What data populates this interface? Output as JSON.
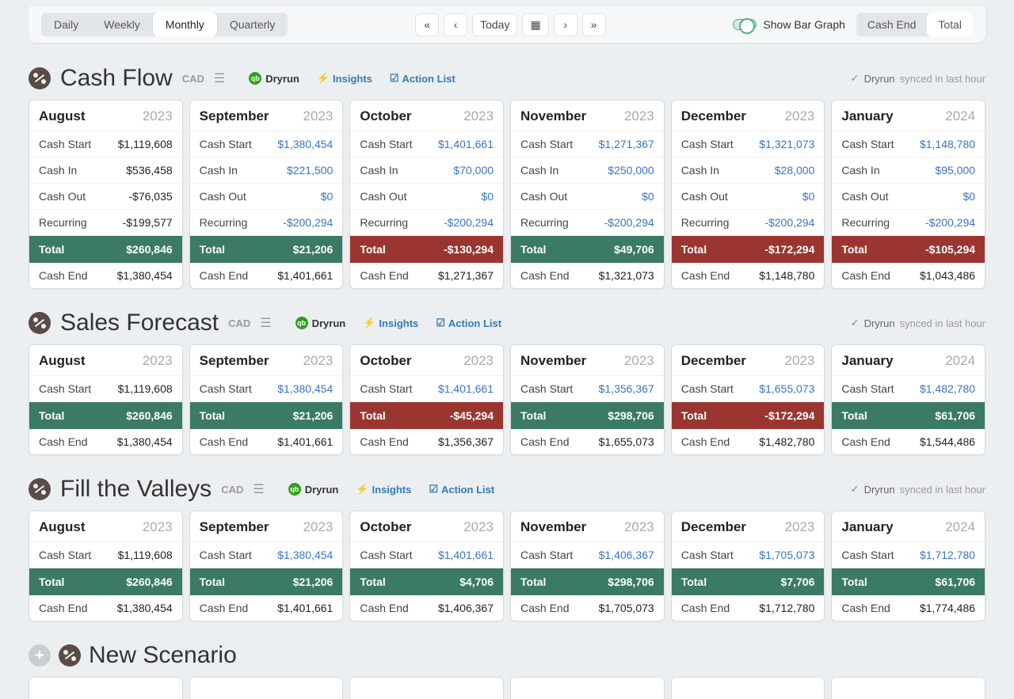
{
  "toolbar": {
    "periods": [
      "Daily",
      "Weekly",
      "Monthly",
      "Quarterly"
    ],
    "today": "Today",
    "show_graph": "Show Bar Graph",
    "totals": [
      "Cash End",
      "Total"
    ]
  },
  "sync": {
    "brand": "Dryrun",
    "text": "synced in last hour"
  },
  "links": {
    "dryrun": "Dryrun",
    "insights": "Insights",
    "actions": "Action List"
  },
  "sections": [
    {
      "title": "Cash Flow",
      "currency": "CAD",
      "months": [
        {
          "name": "August",
          "year": "2023",
          "rows": [
            {
              "label": "Cash Start",
              "value": "$1,119,608",
              "blue": false
            },
            {
              "label": "Cash In",
              "value": "$536,458",
              "blue": false
            },
            {
              "label": "Cash Out",
              "value": "-$76,035",
              "blue": false
            },
            {
              "label": "Recurring",
              "value": "-$199,577",
              "blue": false
            }
          ],
          "total": {
            "label": "Total",
            "value": "$260,846",
            "color": "green"
          },
          "end": {
            "label": "Cash End",
            "value": "$1,380,454"
          }
        },
        {
          "name": "September",
          "year": "2023",
          "rows": [
            {
              "label": "Cash Start",
              "value": "$1,380,454",
              "blue": true
            },
            {
              "label": "Cash In",
              "value": "$221,500",
              "blue": true
            },
            {
              "label": "Cash Out",
              "value": "$0",
              "blue": true
            },
            {
              "label": "Recurring",
              "value": "-$200,294",
              "blue": true
            }
          ],
          "total": {
            "label": "Total",
            "value": "$21,206",
            "color": "green"
          },
          "end": {
            "label": "Cash End",
            "value": "$1,401,661"
          }
        },
        {
          "name": "October",
          "year": "2023",
          "rows": [
            {
              "label": "Cash Start",
              "value": "$1,401,661",
              "blue": true
            },
            {
              "label": "Cash In",
              "value": "$70,000",
              "blue": true
            },
            {
              "label": "Cash Out",
              "value": "$0",
              "blue": true
            },
            {
              "label": "Recurring",
              "value": "-$200,294",
              "blue": true
            }
          ],
          "total": {
            "label": "Total",
            "value": "-$130,294",
            "color": "red"
          },
          "end": {
            "label": "Cash End",
            "value": "$1,271,367"
          }
        },
        {
          "name": "November",
          "year": "2023",
          "rows": [
            {
              "label": "Cash Start",
              "value": "$1,271,367",
              "blue": true
            },
            {
              "label": "Cash In",
              "value": "$250,000",
              "blue": true
            },
            {
              "label": "Cash Out",
              "value": "$0",
              "blue": true
            },
            {
              "label": "Recurring",
              "value": "-$200,294",
              "blue": true
            }
          ],
          "total": {
            "label": "Total",
            "value": "$49,706",
            "color": "green"
          },
          "end": {
            "label": "Cash End",
            "value": "$1,321,073"
          }
        },
        {
          "name": "December",
          "year": "2023",
          "rows": [
            {
              "label": "Cash Start",
              "value": "$1,321,073",
              "blue": true
            },
            {
              "label": "Cash In",
              "value": "$28,000",
              "blue": true
            },
            {
              "label": "Cash Out",
              "value": "$0",
              "blue": true
            },
            {
              "label": "Recurring",
              "value": "-$200,294",
              "blue": true
            }
          ],
          "total": {
            "label": "Total",
            "value": "-$172,294",
            "color": "red"
          },
          "end": {
            "label": "Cash End",
            "value": "$1,148,780"
          }
        },
        {
          "name": "January",
          "year": "2024",
          "rows": [
            {
              "label": "Cash Start",
              "value": "$1,148,780",
              "blue": true
            },
            {
              "label": "Cash In",
              "value": "$95,000",
              "blue": true
            },
            {
              "label": "Cash Out",
              "value": "$0",
              "blue": true
            },
            {
              "label": "Recurring",
              "value": "-$200,294",
              "blue": true
            }
          ],
          "total": {
            "label": "Total",
            "value": "-$105,294",
            "color": "red"
          },
          "end": {
            "label": "Cash End",
            "value": "$1,043,486"
          }
        }
      ]
    },
    {
      "title": "Sales Forecast",
      "currency": "CAD",
      "months": [
        {
          "name": "August",
          "year": "2023",
          "rows": [
            {
              "label": "Cash Start",
              "value": "$1,119,608",
              "blue": false
            }
          ],
          "total": {
            "label": "Total",
            "value": "$260,846",
            "color": "green"
          },
          "end": {
            "label": "Cash End",
            "value": "$1,380,454"
          }
        },
        {
          "name": "September",
          "year": "2023",
          "rows": [
            {
              "label": "Cash Start",
              "value": "$1,380,454",
              "blue": true
            }
          ],
          "total": {
            "label": "Total",
            "value": "$21,206",
            "color": "green"
          },
          "end": {
            "label": "Cash End",
            "value": "$1,401,661"
          }
        },
        {
          "name": "October",
          "year": "2023",
          "rows": [
            {
              "label": "Cash Start",
              "value": "$1,401,661",
              "blue": true
            }
          ],
          "total": {
            "label": "Total",
            "value": "-$45,294",
            "color": "red"
          },
          "end": {
            "label": "Cash End",
            "value": "$1,356,367"
          }
        },
        {
          "name": "November",
          "year": "2023",
          "rows": [
            {
              "label": "Cash Start",
              "value": "$1,356,367",
              "blue": true
            }
          ],
          "total": {
            "label": "Total",
            "value": "$298,706",
            "color": "green"
          },
          "end": {
            "label": "Cash End",
            "value": "$1,655,073"
          }
        },
        {
          "name": "December",
          "year": "2023",
          "rows": [
            {
              "label": "Cash Start",
              "value": "$1,655,073",
              "blue": true
            }
          ],
          "total": {
            "label": "Total",
            "value": "-$172,294",
            "color": "red"
          },
          "end": {
            "label": "Cash End",
            "value": "$1,482,780"
          }
        },
        {
          "name": "January",
          "year": "2024",
          "rows": [
            {
              "label": "Cash Start",
              "value": "$1,482,780",
              "blue": true
            }
          ],
          "total": {
            "label": "Total",
            "value": "$61,706",
            "color": "green"
          },
          "end": {
            "label": "Cash End",
            "value": "$1,544,486"
          }
        }
      ]
    },
    {
      "title": "Fill the Valleys",
      "currency": "CAD",
      "months": [
        {
          "name": "August",
          "year": "2023",
          "rows": [
            {
              "label": "Cash Start",
              "value": "$1,119,608",
              "blue": false
            }
          ],
          "total": {
            "label": "Total",
            "value": "$260,846",
            "color": "green"
          },
          "end": {
            "label": "Cash End",
            "value": "$1,380,454"
          }
        },
        {
          "name": "September",
          "year": "2023",
          "rows": [
            {
              "label": "Cash Start",
              "value": "$1,380,454",
              "blue": true
            }
          ],
          "total": {
            "label": "Total",
            "value": "$21,206",
            "color": "green"
          },
          "end": {
            "label": "Cash End",
            "value": "$1,401,661"
          }
        },
        {
          "name": "October",
          "year": "2023",
          "rows": [
            {
              "label": "Cash Start",
              "value": "$1,401,661",
              "blue": true
            }
          ],
          "total": {
            "label": "Total",
            "value": "$4,706",
            "color": "green"
          },
          "end": {
            "label": "Cash End",
            "value": "$1,406,367"
          }
        },
        {
          "name": "November",
          "year": "2023",
          "rows": [
            {
              "label": "Cash Start",
              "value": "$1,406,367",
              "blue": true
            }
          ],
          "total": {
            "label": "Total",
            "value": "$298,706",
            "color": "green"
          },
          "end": {
            "label": "Cash End",
            "value": "$1,705,073"
          }
        },
        {
          "name": "December",
          "year": "2023",
          "rows": [
            {
              "label": "Cash Start",
              "value": "$1,705,073",
              "blue": true
            }
          ],
          "total": {
            "label": "Total",
            "value": "$7,706",
            "color": "green"
          },
          "end": {
            "label": "Cash End",
            "value": "$1,712,780"
          }
        },
        {
          "name": "January",
          "year": "2024",
          "rows": [
            {
              "label": "Cash Start",
              "value": "$1,712,780",
              "blue": true
            }
          ],
          "total": {
            "label": "Total",
            "value": "$61,706",
            "color": "green"
          },
          "end": {
            "label": "Cash End",
            "value": "$1,774,486"
          }
        }
      ]
    }
  ],
  "new_scenario": "New Scenario"
}
